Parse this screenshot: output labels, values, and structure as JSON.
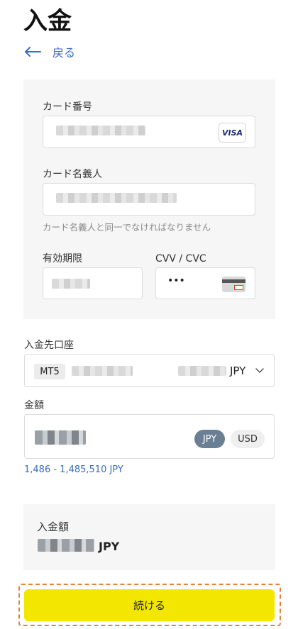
{
  "header": {
    "title": "入金",
    "back_label": "戻る"
  },
  "card_form": {
    "card_number_label": "カード番号",
    "card_brand": "VISA",
    "card_holder_label": "カード名義人",
    "card_holder_hint": "カード名義人と同一でなければなりません",
    "expiry_label": "有効期限",
    "cvv_label": "CVV / CVC",
    "cvv_value": "•••"
  },
  "account": {
    "label": "入金先口座",
    "platform": "MT5",
    "currency": "JPY"
  },
  "amount": {
    "label": "金額",
    "currencies": [
      "JPY",
      "USD"
    ],
    "selected_currency": "JPY",
    "range": "1,486 - 1,485,510 JPY"
  },
  "summary": {
    "label": "入金額",
    "currency": "JPY"
  },
  "continue_label": "続ける",
  "colors": {
    "accent": "#3b6dc2",
    "button": "#f3e600",
    "highlight": "#e58336",
    "panel": "#f5f6f5"
  }
}
